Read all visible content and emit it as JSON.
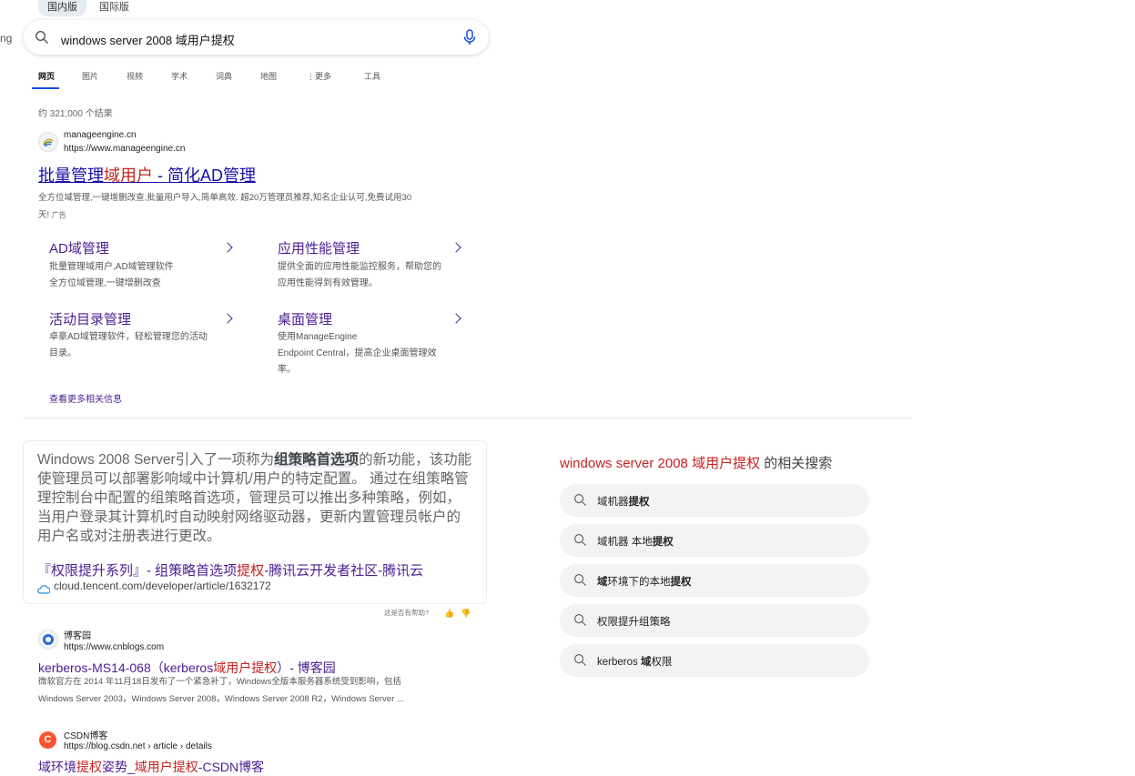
{
  "scope_tabs": [
    "国内版",
    "国际版"
  ],
  "edge_text": "ng",
  "search": {
    "query": "windows server 2008 域用户提权"
  },
  "nav_tabs": [
    "网页",
    "图片",
    "视频",
    "学术",
    "词典",
    "地图",
    "更多",
    "工具"
  ],
  "result_count": "约 321,000 个结果",
  "ad": {
    "site_name": "manageengine.cn",
    "url": "https://www.manageengine.cn",
    "title_a": "批量管理",
    "title_hl": "域用户",
    "title_b": " - 简化AD管理",
    "snippet_line1": "全方位域管理,一键增删改查,批量用户导入,简单高效. 超20万管理员推荐,知名企业认可,免费试用30",
    "snippet_line2": "天!",
    "ad_label": "广告",
    "sitelinks": [
      {
        "title": "AD域管理",
        "desc1": "批量管理域用户,AD域管理软件",
        "desc2": "全方位域管理,一键增删改查",
        "desc3": ""
      },
      {
        "title": "应用性能管理",
        "desc1": "提供全面的应用性能监控服务，帮助您的",
        "desc2": "应用性能得到有效管理。",
        "desc3": ""
      },
      {
        "title": "活动目录管理",
        "desc1": "卓豪AD域管理软件，轻松管理您的活动",
        "desc2": "目录。",
        "desc3": ""
      },
      {
        "title": "桌面管理",
        "desc1": "使用ManageEngine",
        "desc2": "Endpoint Central，提高企业桌面管理效",
        "desc3": "率。"
      }
    ],
    "more_link": "查看更多相关信息"
  },
  "answer": {
    "text_a": "Windows 2008 Server引入了一项称为",
    "text_hl": "组策略首选项",
    "text_b": "的新功能，该功能使管理员可以部署影响域中计算机/用户的特定配置。 通过在组策略管理控制台中配置的组策略首选项，管理员可以推出多种策略，例如，当用户登录其计算机时自动映射网络驱动器，更新内置管理员帐户的用户名或对注册表进行更改。",
    "link_a": "『权限提升系列』- 组策略首选项",
    "link_hl": "提权",
    "link_b": "-腾讯云开发者社区-腾讯云",
    "url": "cloud.tencent.com/developer/article/1632172",
    "helpful": "这是否有帮助?"
  },
  "results": [
    {
      "site_name": "博客园",
      "url": "https://www.cnblogs.com",
      "title_a": "kerberos-MS14-068（kerberos",
      "title_hl": "域用户提权",
      "title_b": "）- 博客园",
      "snippet1": "微软官方在 2014 年11月18日发布了一个紧急补丁，Windows全版本服务器系统受到影响，包括",
      "snippet2": "Windows Server 2003，Windows Server 2008，Windows Server 2008 R2，Windows Server ..."
    },
    {
      "site_name": "CSDN博客",
      "url": "https://blog.csdn.net › article › details",
      "title_a": "域环境",
      "title_hl": "提权",
      "title_b": "姿势_",
      "title_hl2": "域用户提权",
      "title_c": "-CSDN博客"
    }
  ],
  "related": {
    "title_hl": "windows server 2008 域用户提权",
    "title_rest": " 的相关搜索",
    "items": [
      {
        "a": "域机器",
        "b": "提权",
        "c": ""
      },
      {
        "a": "域机器 本地",
        "b": "提权",
        "c": ""
      },
      {
        "a": "域环境下的本地",
        "b": "提权",
        "c": ""
      },
      {
        "a": "",
        "b": "",
        "c": "权限提升组策略"
      },
      {
        "a": "kerberos ",
        "b": "域",
        "c": "权限"
      }
    ]
  },
  "colors": {
    "link": "#1a0dab",
    "visited": "#4b1e91",
    "highlight": "#c5221f",
    "accent": "#174ae4"
  }
}
